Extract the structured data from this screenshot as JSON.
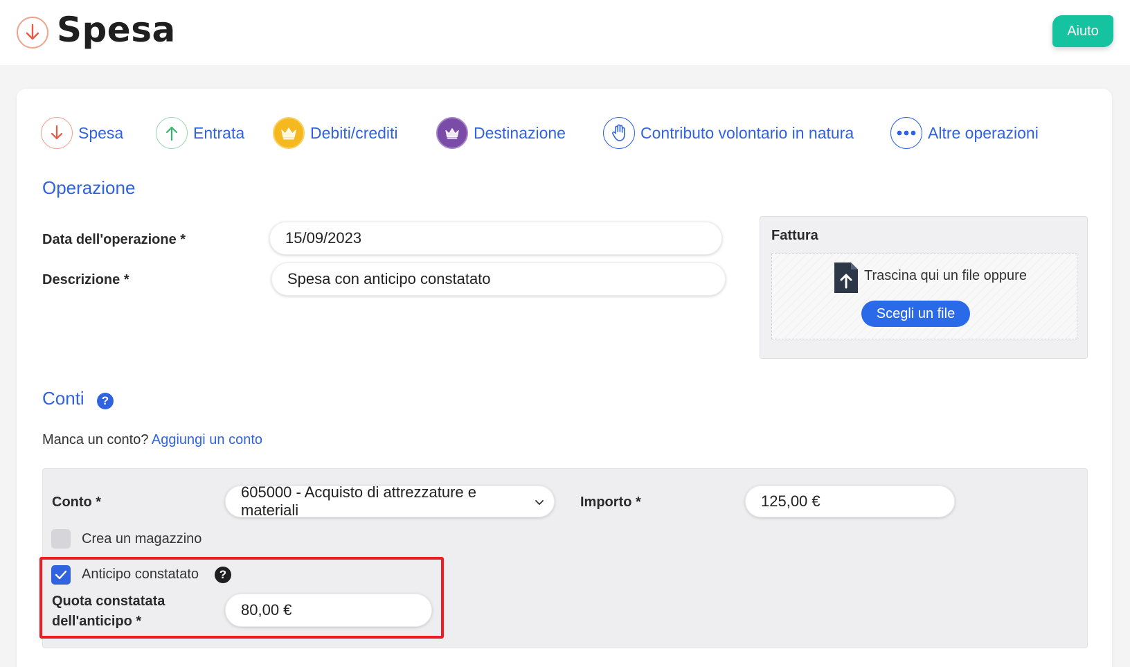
{
  "header": {
    "title": "Spesa",
    "help_label": "Aiuto"
  },
  "tabs": [
    {
      "label": "Spesa",
      "icon": "arrow-down-icon",
      "color": "#e85a43"
    },
    {
      "label": "Entrata",
      "icon": "arrow-up-icon",
      "color": "#37b56a"
    },
    {
      "label": "Debiti/crediti",
      "icon": "crown-icon",
      "color": "#f2b51d"
    },
    {
      "label": "Destinazione",
      "icon": "crown-transfer-icon",
      "color": "#7b4ba8"
    },
    {
      "label": "Contributo volontario in natura",
      "icon": "hand-icon",
      "color": "#2f63e0"
    },
    {
      "label": "Altre operazioni",
      "icon": "more-dots-icon",
      "color": "#2f63e0"
    }
  ],
  "operazione": {
    "section_title": "Operazione",
    "date_label": "Data dell'operazione *",
    "date_value": "15/09/2023",
    "description_label": "Descrizione *",
    "description_value": "Spesa con anticipo constatato"
  },
  "fattura": {
    "title": "Fattura",
    "drop_text": "Trascina qui un file oppure",
    "choose_label": "Scegli un file"
  },
  "conti": {
    "section_title": "Conti",
    "help_glyph": "?",
    "missing_text": "Manca un conto?",
    "add_link": "Aggiungi un conto",
    "conto_label": "Conto *",
    "conto_value": "605000 - Acquisto di attrezzature e materiali",
    "importo_label": "Importo *",
    "importo_value": "125,00 €",
    "magazzino_label": "Crea un magazzino",
    "magazzino_checked": false,
    "anticipo_label": "Anticipo constatato",
    "anticipo_checked": true,
    "quota_label_line1": "Quota constatata",
    "quota_label_line2": "dell'anticipo *",
    "quota_value": "80,00 €"
  },
  "colors": {
    "accent": "#2f63e0",
    "help_button": "#15c3a0",
    "highlight": "#ee1c24"
  }
}
